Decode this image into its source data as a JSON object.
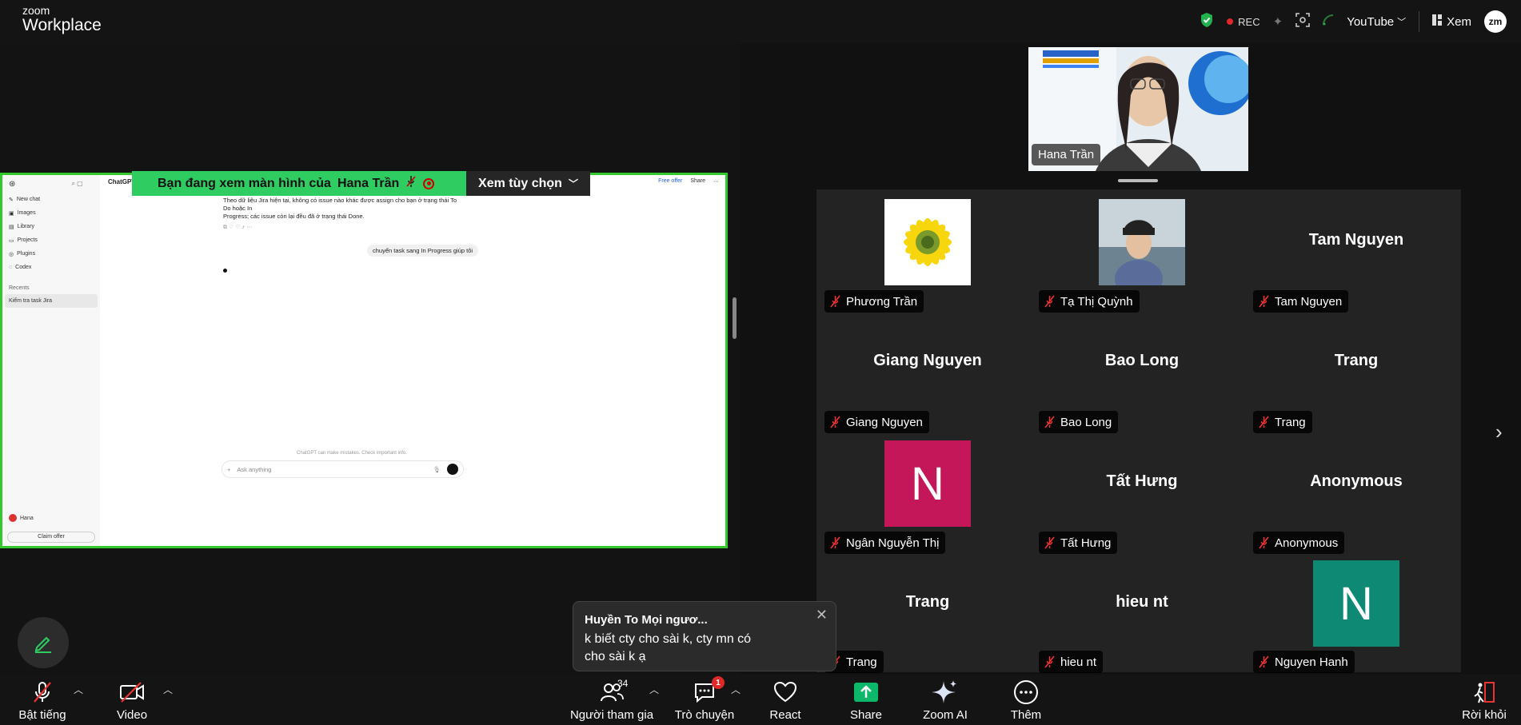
{
  "app": {
    "logo_top": "zoom",
    "logo_bottom": "Workplace"
  },
  "header": {
    "rec": "REC",
    "youtube": "YouTube",
    "view": "Xem",
    "avatar": "zm"
  },
  "share": {
    "banner_text": "Bạn đang xem màn hình của",
    "banner_name": "Hana Trần",
    "options": "Xem tùy chọn",
    "app_title": "ChatGPT",
    "sidebar": [
      "New chat",
      "Images",
      "Library",
      "Projects",
      "Plugins",
      "Codex"
    ],
    "recents_label": "Recents",
    "recent_item": "Kiểm tra task Jira",
    "answer_line1": "Theo dữ liệu Jira hiện tại, không có issue nào khác được assign cho bạn ở trạng thái To Do hoặc In",
    "answer_line2": "Progress; các issue còn lại đều đã ở trạng thái Done.",
    "user_msg": "chuyển task sang In Progress giúp tôi",
    "free_offer": "Free offer",
    "share_btn": "Share",
    "disclaimer": "ChatGPT can make mistakes. Check important info.",
    "ask_placeholder": "Ask anything",
    "user_name": "Hana",
    "claim_offer": "Claim offer"
  },
  "spotlight": {
    "name": "Hana Trần"
  },
  "participants": [
    {
      "name": "Phương Trần",
      "big": ""
    },
    {
      "name": "Tạ Thị Quỳnh",
      "big": ""
    },
    {
      "name": "Tam Nguyen",
      "big": "Tam Nguyen"
    },
    {
      "name": "Giang Nguyen",
      "big": "Giang Nguyen"
    },
    {
      "name": "Bao Long",
      "big": "Bao Long"
    },
    {
      "name": "Trang",
      "big": "Trang"
    },
    {
      "name": "Ngân Nguyễn Thị",
      "big": "",
      "letter": "N",
      "color": "#c3175a"
    },
    {
      "name": "Tất Hưng",
      "big": "Tất Hưng"
    },
    {
      "name": "Anonymous",
      "big": "Anonymous"
    },
    {
      "name": "Trang",
      "big": "Trang"
    },
    {
      "name": "hieu nt",
      "big": "hieu nt"
    },
    {
      "name": "Nguyen Hanh",
      "big": "",
      "letter": "N",
      "color": "#0e8a74"
    }
  ],
  "chat_toast": {
    "from": "Huyền To Mọi ngươ...",
    "line1": "k biết cty cho sài k, cty mn có",
    "line2": "cho sài k ạ"
  },
  "toolbar": {
    "mute": "Bật tiếng",
    "video": "Video",
    "participants": "Người tham gia",
    "participants_count": "34",
    "chat": "Trò chuyện",
    "chat_badge": "1",
    "react": "React",
    "share": "Share",
    "zoom_ai": "Zoom AI",
    "more": "Thêm",
    "leave": "Rời khỏi"
  },
  "colors": {
    "share_border": "#33c92e",
    "banner": "#2fcc62",
    "share_btn": "#0bb86a",
    "rec": "#e02828"
  }
}
